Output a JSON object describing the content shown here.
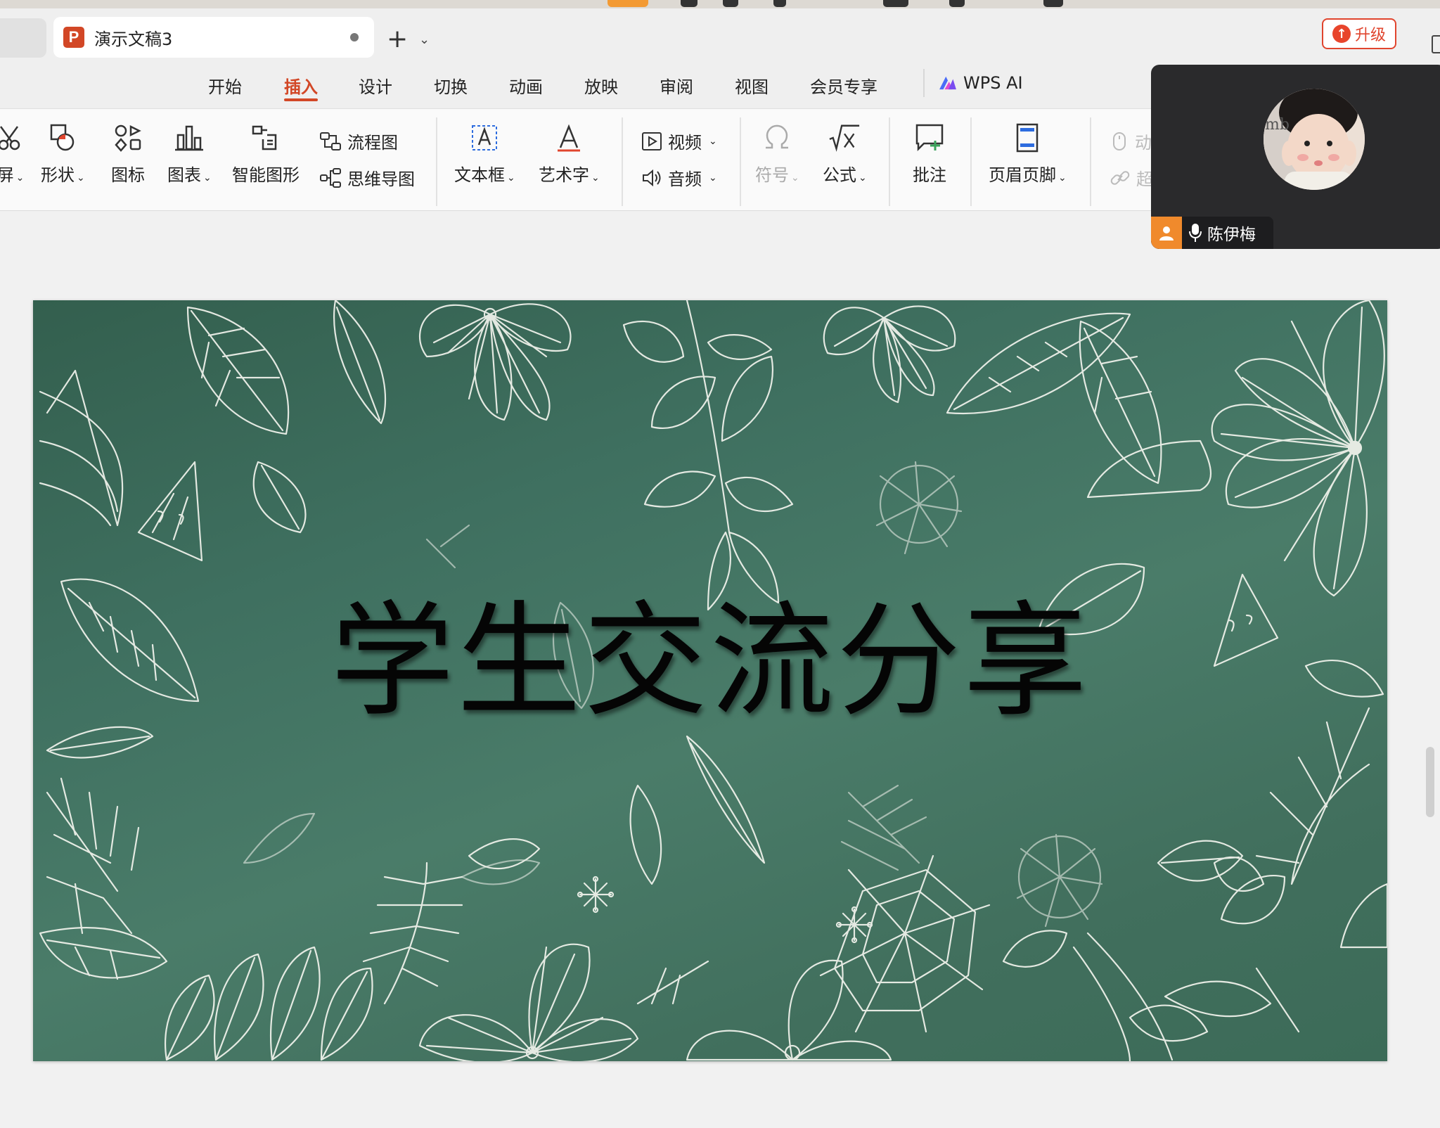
{
  "tab": {
    "app_badge": "P",
    "title": "演示文稿3"
  },
  "upgrade_label": "升级",
  "menu": [
    "开始",
    "插入",
    "设计",
    "切换",
    "动画",
    "放映",
    "审阅",
    "视图",
    "会员专享"
  ],
  "wps_ai_label": "WPS AI",
  "ribbon": {
    "screen_partial": "屏",
    "shape": "形状",
    "icons": "图标",
    "chart": "图表",
    "smart_art": "智能图形",
    "flowchart": "流程图",
    "mindmap": "思维导图",
    "textbox": "文本框",
    "wordart": "艺术字",
    "video": "视频",
    "audio": "音频",
    "symbol": "符号",
    "formula": "公式",
    "comment": "批注",
    "header_footer": "页眉页脚",
    "action_partial": "动",
    "link_partial": "超"
  },
  "slide": {
    "title": "学生交流分享"
  },
  "participant": {
    "name": "陈伊梅"
  }
}
